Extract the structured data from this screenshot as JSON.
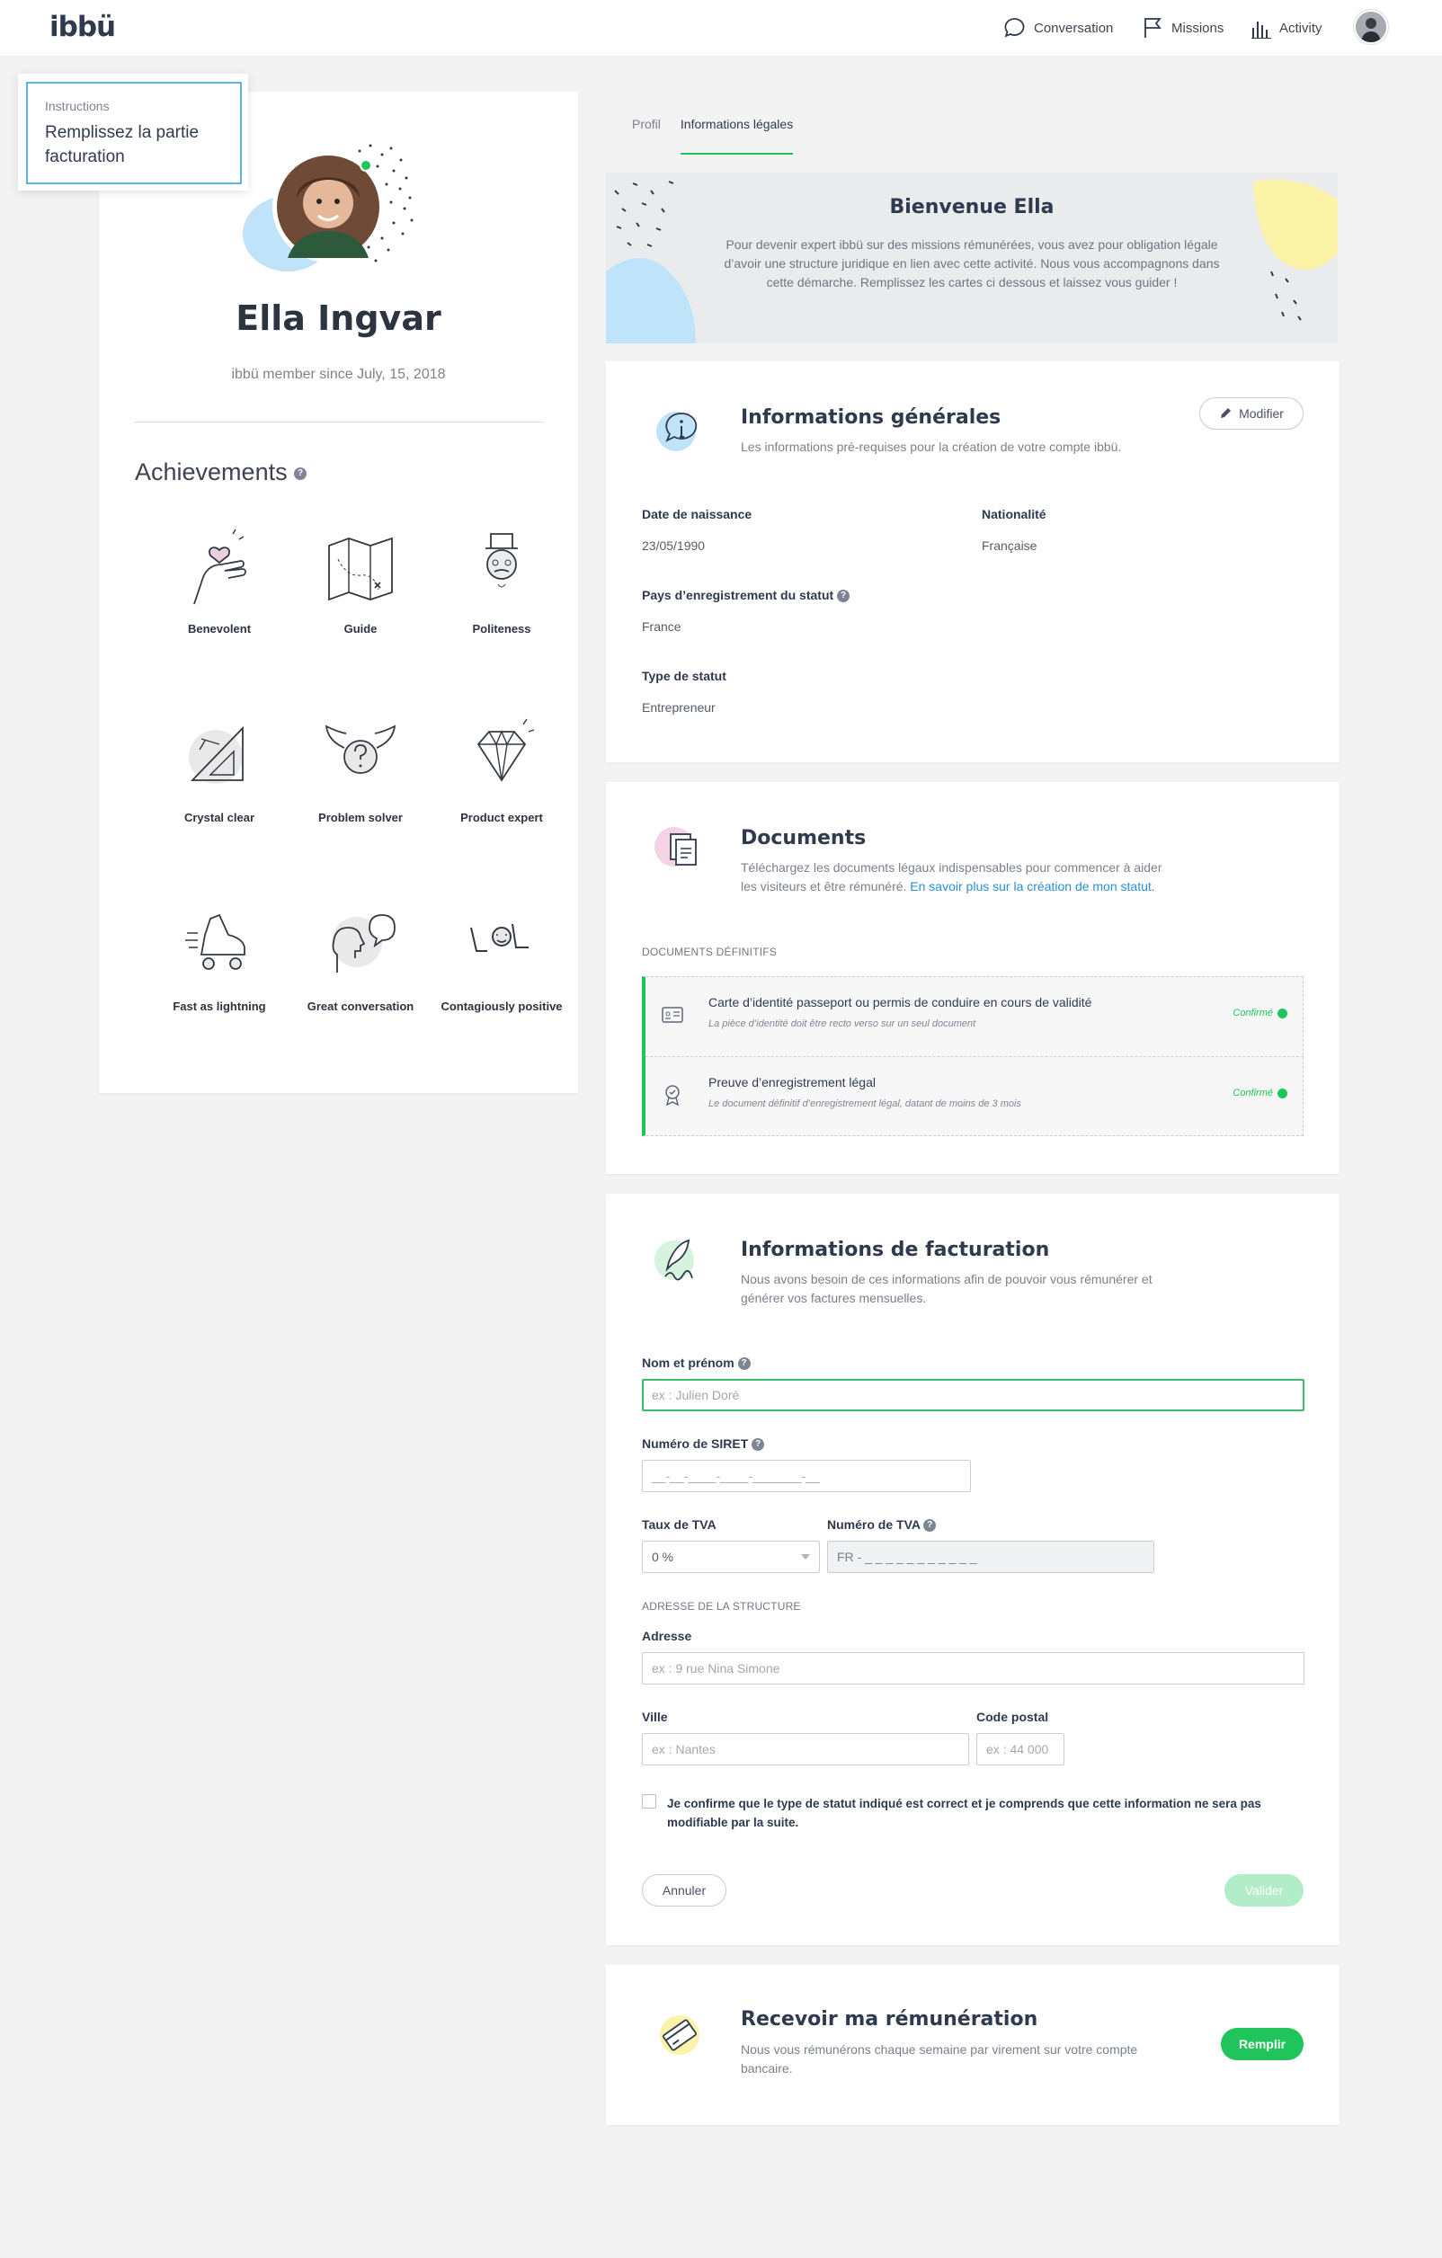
{
  "nav": {
    "logo": "ibbü",
    "conversation": "Conversation",
    "missions": "Missions",
    "activity": "Activity"
  },
  "instructions": {
    "title": "Instructions",
    "text": "Remplissez la partie facturation"
  },
  "profile": {
    "name": "Ella Ingvar",
    "member_since": "ibbü member since July, 15, 2018",
    "achievements_title": "Achievements",
    "achievements": [
      {
        "label": "Benevolent",
        "icon": "hand-heart-icon"
      },
      {
        "label": "Guide",
        "icon": "map-icon"
      },
      {
        "label": "Politeness",
        "icon": "gentleman-icon"
      },
      {
        "label": "Crystal clear",
        "icon": "set-square-icon"
      },
      {
        "label": "Problem solver",
        "icon": "winged-question-icon"
      },
      {
        "label": "Product expert",
        "icon": "diamond-icon"
      },
      {
        "label": "Fast as lightning",
        "icon": "roller-skate-icon"
      },
      {
        "label": "Great conversation",
        "icon": "talking-head-icon"
      },
      {
        "label": "Contagiously positive",
        "icon": "lol-icon"
      }
    ]
  },
  "tabs": [
    {
      "label": "Profil",
      "active": false
    },
    {
      "label": "Informations légales",
      "active": true
    }
  ],
  "welcome": {
    "title": "Bienvenue Ella",
    "text": "Pour devenir expert ibbü sur des missions rémunérées, vous avez pour obligation légale d’avoir une structure juridique en lien avec cette activité. Nous vous accompagnons dans cette démarche. Remplissez les cartes ci dessous et laissez vous guider !"
  },
  "general": {
    "title": "Informations générales",
    "subtitle": "Les informations pré-requises pour la création de votre compte ibbü.",
    "edit_label": "Modifier",
    "birth_label": "Date de naissance",
    "birth_value": "23/05/1990",
    "nationality_label": "Nationalité",
    "nationality_value": "Française",
    "country_label": "Pays d’enregistrement du statut",
    "country_value": "France",
    "status_label": "Type de statut",
    "status_value": "Entrepreneur"
  },
  "documents": {
    "title": "Documents",
    "subtitle": "Téléchargez les documents légaux indispensables pour commencer à aider les visiteurs et être rémunéré.",
    "link": "En savoir plus sur la création de mon statut.",
    "section": "DOCUMENTS DÉFINITIFS",
    "items": [
      {
        "title": "Carte d’identité passeport ou permis de conduire en cours de validité",
        "sub": "La pièce d’identité doit être recto verso sur un seul document",
        "status": "Confirmé"
      },
      {
        "title": "Preuve d’enregistrement légal",
        "sub": "Le document définitif d’enregistrement légal, datant de moins de 3 mois",
        "status": "Confirmé"
      }
    ]
  },
  "billing": {
    "title": "Informations de facturation",
    "subtitle": "Nous avons besoin de ces informations afin de pouvoir vous rémunérer et générer vos factures mensuelles.",
    "name_label": "Nom et prénom",
    "name_placeholder": "ex : Julien Doré",
    "siret_label": "Numéro de SIRET",
    "siret_placeholder": "__-__-____-____-_______-__",
    "tva_rate_label": "Taux de TVA",
    "tva_rate_value": "0 %",
    "tva_num_label": "Numéro de TVA",
    "tva_num_value": "FR -  _ _ _ _ _ _ _ _ _ _ _",
    "address_section": "ADRESSE DE LA STRUCTURE",
    "address_label": "Adresse",
    "address_placeholder": "ex : 9 rue Nina Simone",
    "city_label": "Ville",
    "city_placeholder": "ex : Nantes",
    "zip_label": "Code postal",
    "zip_placeholder": "ex : 44 000",
    "confirm_text": "Je confirme que le type de statut indiqué est correct et je comprends que cette information ne sera pas modifiable par la suite.",
    "cancel": "Annuler",
    "submit": "Valider"
  },
  "payment": {
    "title": "Recevoir ma rémunération",
    "subtitle": "Nous vous rémunérons chaque semaine par virement sur votre compte bancaire.",
    "button": "Remplir"
  },
  "colors": {
    "accent": "#1fc45b",
    "link": "#2a8fd6",
    "instruction_border": "#5ab4e8"
  }
}
